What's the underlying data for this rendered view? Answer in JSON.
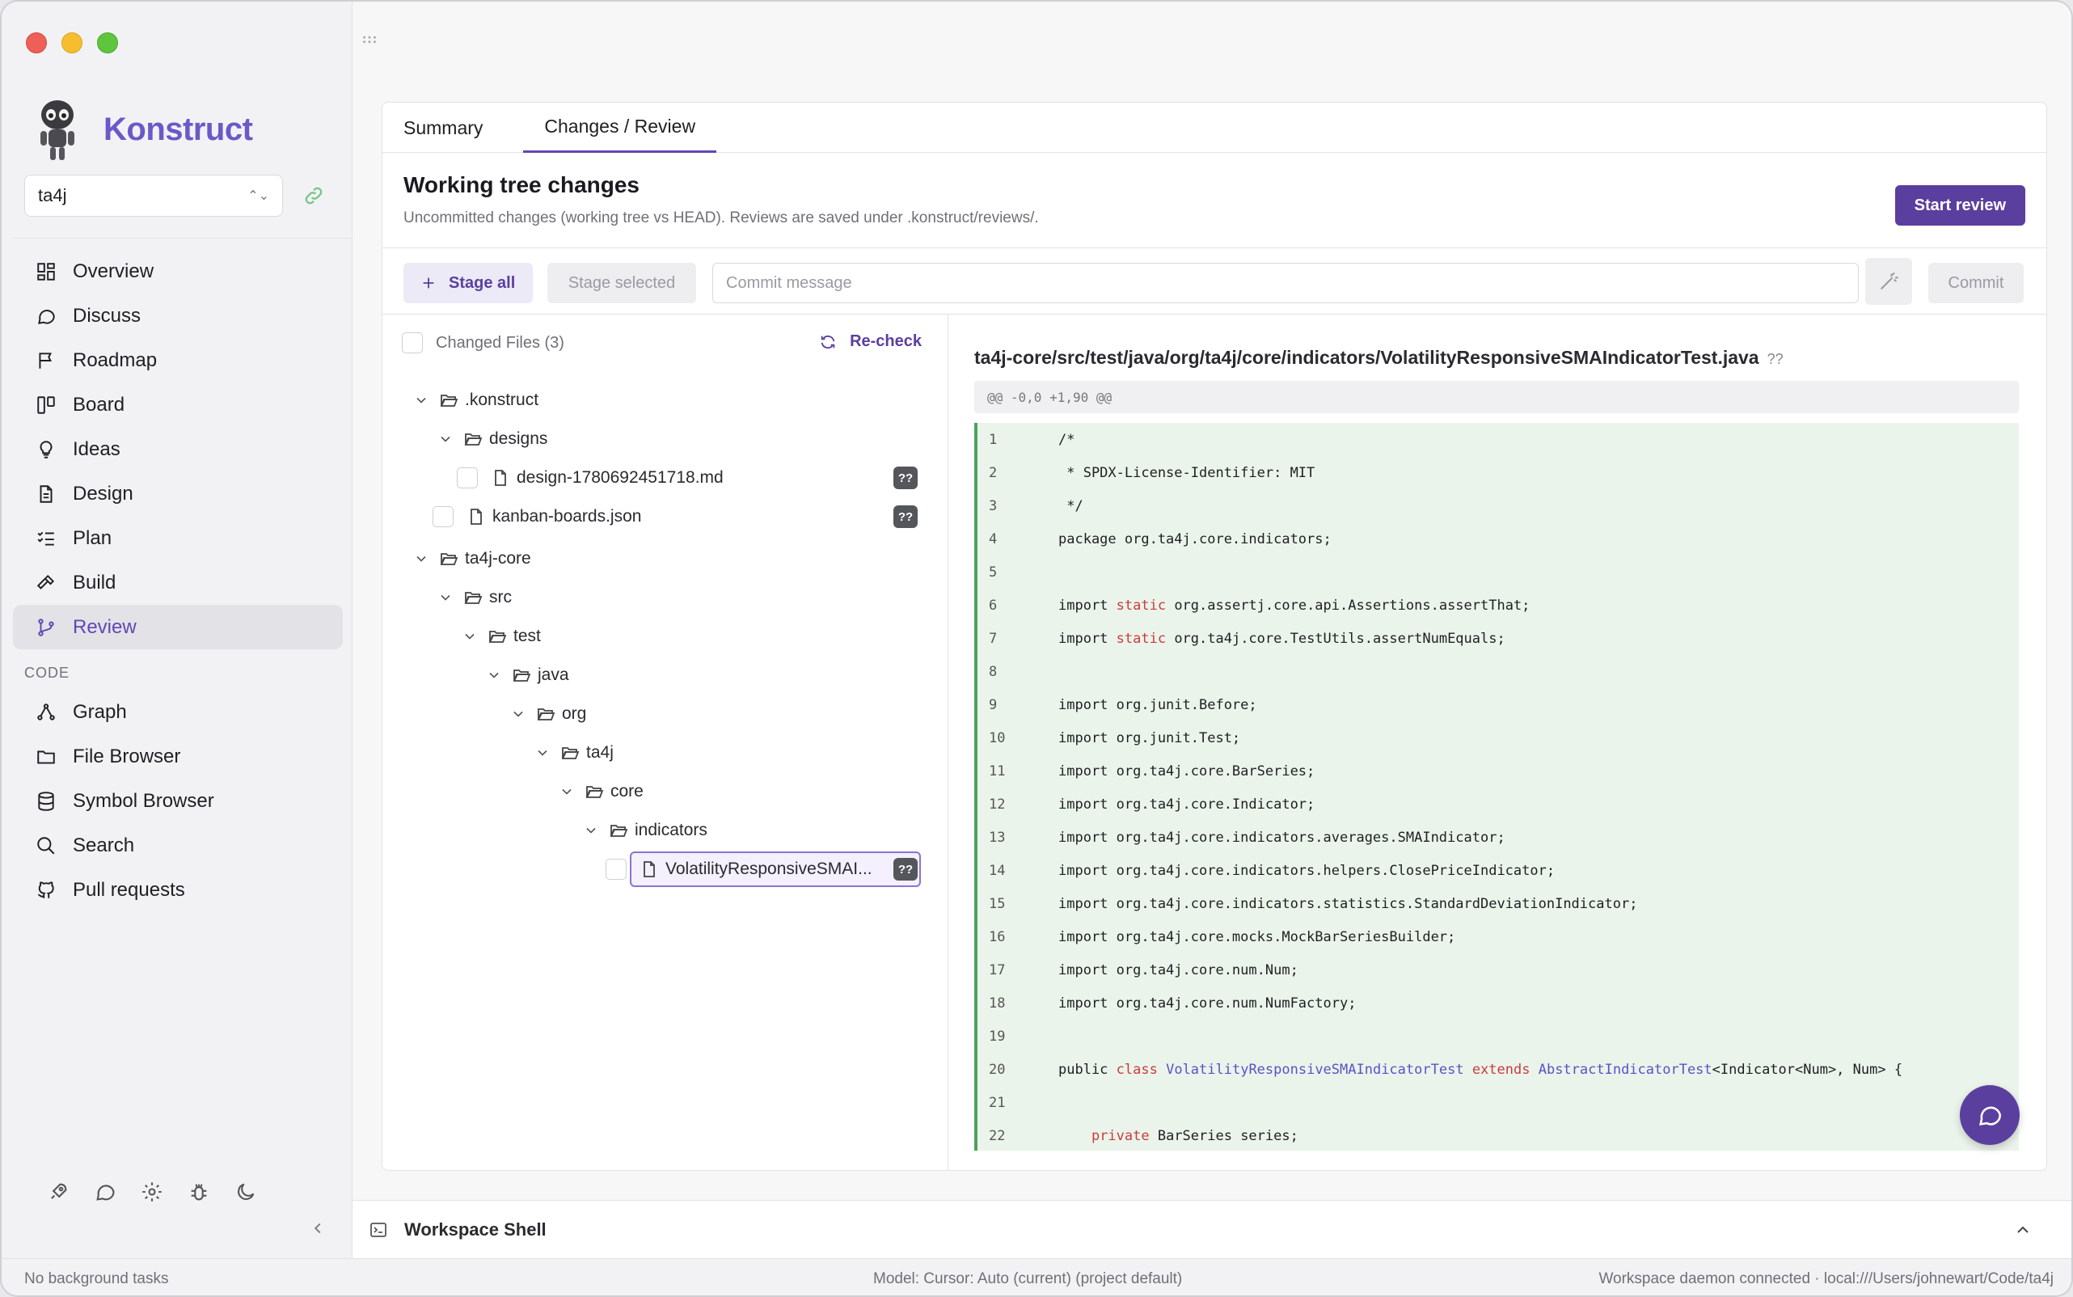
{
  "app": {
    "name": "Konstruct",
    "project": "ta4j"
  },
  "sidebar": {
    "items": [
      {
        "label": "Overview",
        "icon": "grid-icon"
      },
      {
        "label": "Discuss",
        "icon": "chat-icon"
      },
      {
        "label": "Roadmap",
        "icon": "flag-icon"
      },
      {
        "label": "Board",
        "icon": "board-icon"
      },
      {
        "label": "Ideas",
        "icon": "lightbulb-icon"
      },
      {
        "label": "Design",
        "icon": "document-icon"
      },
      {
        "label": "Plan",
        "icon": "checklist-icon"
      },
      {
        "label": "Build",
        "icon": "hammer-icon"
      },
      {
        "label": "Review",
        "icon": "git-branch-icon",
        "active": true
      }
    ],
    "code_section": "CODE",
    "code_items": [
      {
        "label": "Graph",
        "icon": "graph-icon"
      },
      {
        "label": "File Browser",
        "icon": "folder-icon"
      },
      {
        "label": "Symbol Browser",
        "icon": "database-icon"
      },
      {
        "label": "Search",
        "icon": "search-icon"
      },
      {
        "label": "Pull requests",
        "icon": "github-icon"
      }
    ]
  },
  "tabs": [
    {
      "label": "Summary"
    },
    {
      "label": "Changes / Review",
      "active": true
    }
  ],
  "header": {
    "title": "Working tree changes",
    "subtitle": "Uncommitted changes (working tree vs HEAD). Reviews are saved under .konstruct/reviews/.",
    "start_review": "Start review"
  },
  "toolbar": {
    "stage_all": "Stage all",
    "stage_selected": "Stage selected",
    "commit_placeholder": "Commit message",
    "commit": "Commit"
  },
  "tree": {
    "header": "Changed Files (3)",
    "recheck": "Re-check",
    "rows": [
      {
        "label": ".konstruct"
      },
      {
        "label": "designs"
      },
      {
        "label": "design-1780692451718.md",
        "badge": "??"
      },
      {
        "label": "kanban-boards.json",
        "badge": "??"
      },
      {
        "label": "ta4j-core"
      },
      {
        "label": "src"
      },
      {
        "label": "test"
      },
      {
        "label": "java"
      },
      {
        "label": "org"
      },
      {
        "label": "ta4j"
      },
      {
        "label": "core"
      },
      {
        "label": "indicators"
      },
      {
        "label": "VolatilityResponsiveSMAI...",
        "badge": "??"
      }
    ]
  },
  "diff": {
    "path": "ta4j-core/src/test/java/org/ta4j/core/indicators/VolatilityResponsiveSMAIndicatorTest.java",
    "status": "??",
    "hunk": "@@ -0,0 +1,90 @@",
    "lines": [
      {
        "n": "1",
        "segs": [
          [
            "",
            "/*"
          ]
        ]
      },
      {
        "n": "2",
        "segs": [
          [
            "",
            " * SPDX-License-Identifier: MIT"
          ]
        ]
      },
      {
        "n": "3",
        "segs": [
          [
            "",
            " */"
          ]
        ]
      },
      {
        "n": "4",
        "segs": [
          [
            "",
            "package org.ta4j.core.indicators;"
          ]
        ]
      },
      {
        "n": "5",
        "segs": [
          [
            "",
            ""
          ]
        ]
      },
      {
        "n": "6",
        "segs": [
          [
            "",
            "import "
          ],
          [
            "kw",
            "static"
          ],
          [
            "",
            " org.assertj.core.api.Assertions.assertThat;"
          ]
        ]
      },
      {
        "n": "7",
        "segs": [
          [
            "",
            "import "
          ],
          [
            "kw",
            "static"
          ],
          [
            "",
            " org.ta4j.core.TestUtils.assertNumEquals;"
          ]
        ]
      },
      {
        "n": "8",
        "segs": [
          [
            "",
            ""
          ]
        ]
      },
      {
        "n": "9",
        "segs": [
          [
            "",
            "import org.junit.Before;"
          ]
        ]
      },
      {
        "n": "10",
        "segs": [
          [
            "",
            "import org.junit.Test;"
          ]
        ]
      },
      {
        "n": "11",
        "segs": [
          [
            "",
            "import org.ta4j.core.BarSeries;"
          ]
        ]
      },
      {
        "n": "12",
        "segs": [
          [
            "",
            "import org.ta4j.core.Indicator;"
          ]
        ]
      },
      {
        "n": "13",
        "segs": [
          [
            "",
            "import org.ta4j.core.indicators.averages.SMAIndicator;"
          ]
        ]
      },
      {
        "n": "14",
        "segs": [
          [
            "",
            "import org.ta4j.core.indicators.helpers.ClosePriceIndicator;"
          ]
        ]
      },
      {
        "n": "15",
        "segs": [
          [
            "",
            "import org.ta4j.core.indicators.statistics.StandardDeviationIndicator;"
          ]
        ]
      },
      {
        "n": "16",
        "segs": [
          [
            "",
            "import org.ta4j.core.mocks.MockBarSeriesBuilder;"
          ]
        ]
      },
      {
        "n": "17",
        "segs": [
          [
            "",
            "import org.ta4j.core.num.Num;"
          ]
        ]
      },
      {
        "n": "18",
        "segs": [
          [
            "",
            "import org.ta4j.core.num.NumFactory;"
          ]
        ]
      },
      {
        "n": "19",
        "segs": [
          [
            "",
            ""
          ]
        ]
      },
      {
        "n": "20",
        "segs": [
          [
            "",
            "public "
          ],
          [
            "kw",
            "class"
          ],
          [
            "",
            " "
          ],
          [
            "ty",
            "VolatilityResponsiveSMAIndicatorTest"
          ],
          [
            "",
            " "
          ],
          [
            "kw",
            "extends"
          ],
          [
            "",
            " "
          ],
          [
            "ty",
            "AbstractIndicatorTest"
          ],
          [
            "",
            "<Indicator<Num>, Num> {"
          ]
        ]
      },
      {
        "n": "21",
        "segs": [
          [
            "",
            ""
          ]
        ]
      },
      {
        "n": "22",
        "segs": [
          [
            "",
            "    "
          ],
          [
            "kw",
            "private"
          ],
          [
            "",
            " BarSeries series;"
          ]
        ]
      }
    ]
  },
  "shell": {
    "label": "Workspace Shell"
  },
  "status": {
    "left": "No background tasks",
    "center": "Model: Cursor: Auto (current) (project default)",
    "right": "Workspace daemon connected · local:///Users/johnewart/Code/ta4j"
  }
}
